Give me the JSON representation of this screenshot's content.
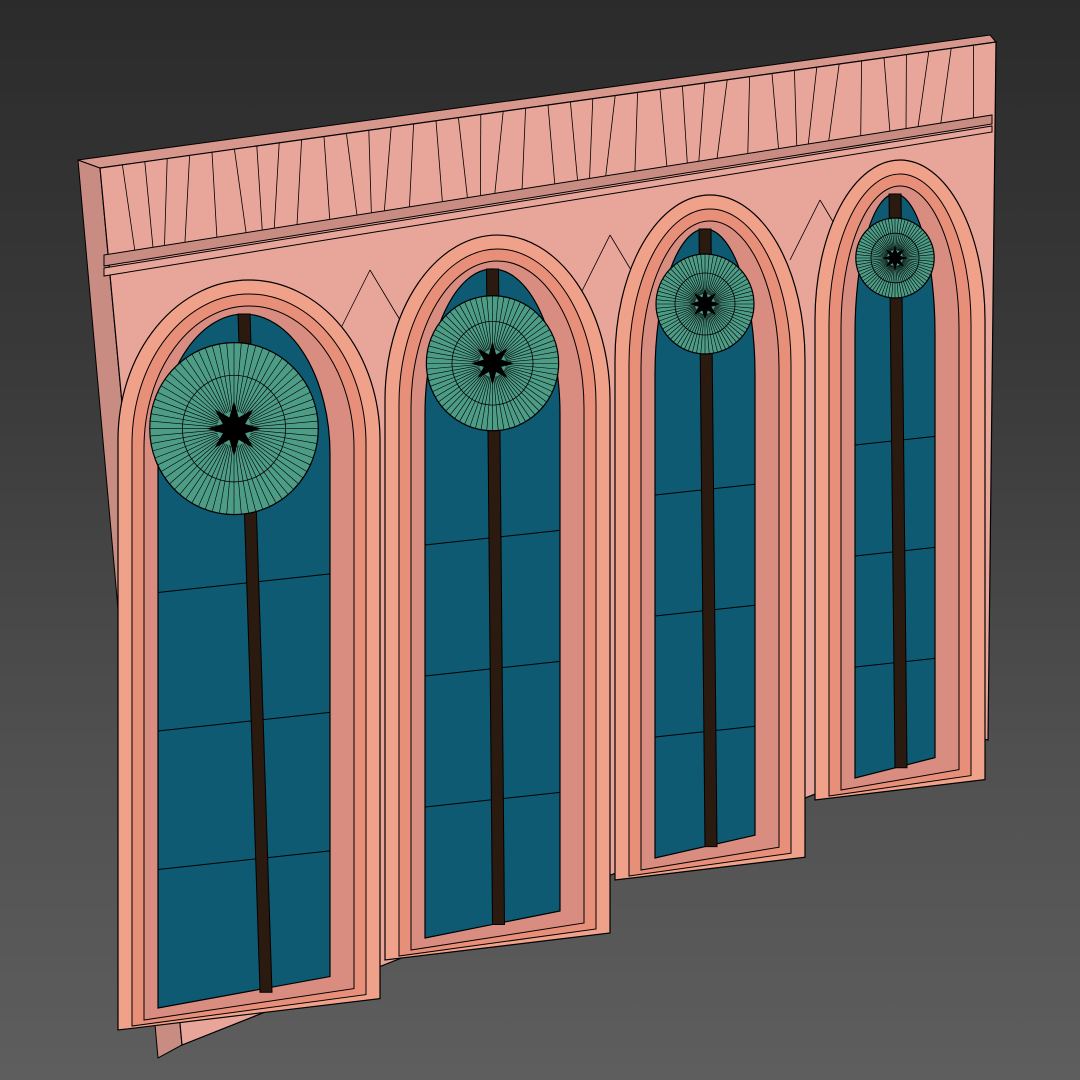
{
  "viewport": {
    "background_top": "#2b2b2b",
    "background_bottom": "#5e5e5e"
  },
  "model": {
    "description_kind": "wireframe-over-shaded",
    "arch_count": 4,
    "colors": {
      "wall_face": "#e8a59a",
      "wall_side": "#c98c82",
      "arch_frame": "#f0a18a",
      "arch_frame_inner": "#e78f78",
      "glass": "#0f5a73",
      "glass_dark": "#0b4a61",
      "mullion": "#2a1a10",
      "rose_window": "#4d9c86",
      "rose_center": "#000000",
      "wire": "#000000"
    }
  }
}
